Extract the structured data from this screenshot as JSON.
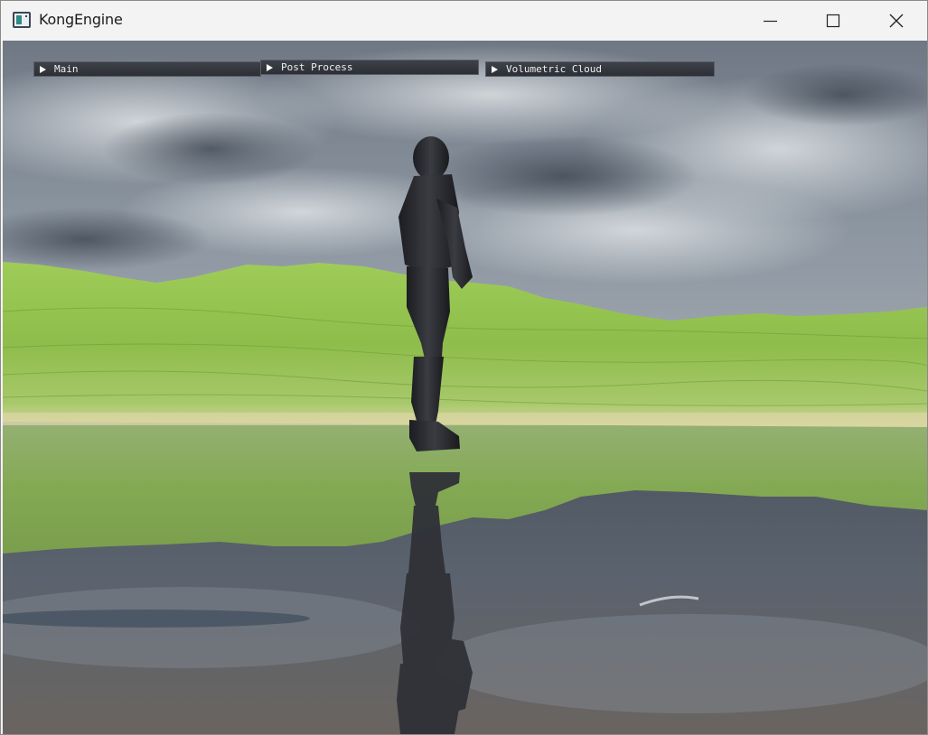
{
  "window": {
    "title": "KongEngine",
    "icon": "app-window-icon",
    "controls": {
      "minimize_icon": "minimize-icon",
      "maximize_icon": "maximize-icon",
      "close_icon": "close-icon"
    }
  },
  "panels": [
    {
      "label": "Main",
      "icon": "collapsed-arrow-icon",
      "expanded": false
    },
    {
      "label": "Post Process",
      "icon": "collapsed-arrow-icon",
      "expanded": false
    },
    {
      "label": "Volumetric Cloud",
      "icon": "collapsed-arrow-icon",
      "expanded": false
    }
  ],
  "colors": {
    "sky": "#7e8a97",
    "cloud": "#c9ced3",
    "terrain": "#8fbf4a",
    "water": "#4e5661",
    "character": "#26282c",
    "panel_bg": "#33363c",
    "panel_text": "#f0f0f0"
  }
}
